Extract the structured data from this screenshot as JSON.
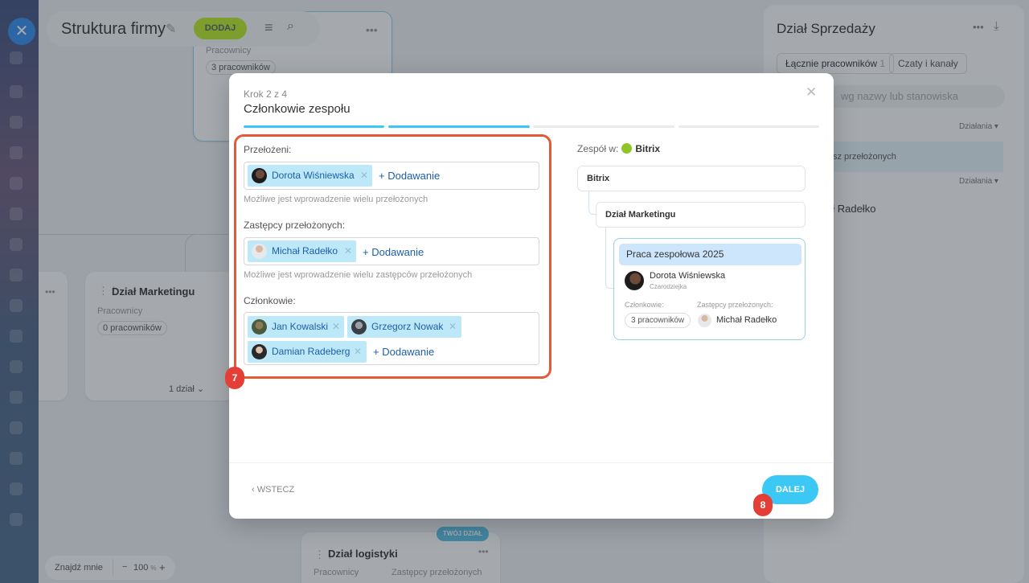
{
  "app": {
    "title": "Struktura firmy",
    "add_label": "DODAJ"
  },
  "background": {
    "top_card": {
      "employees_label": "Pracownicy",
      "employees_count": "3 pracowników"
    },
    "marketing_card": {
      "name": "Dział Marketingu",
      "employees_label": "Pracownicy",
      "employees_count": "0 pracowników",
      "subdept": "1 dział"
    },
    "logistics_card": {
      "badge": "TWÓJ DZIAŁ",
      "name": "Dział logistyki",
      "employees_label": "Pracownicy",
      "deputies_label": "Zastępcy przełożonych"
    },
    "right_panel": {
      "title": "Dział Sprzedaży",
      "tab_total": "Łącznie pracowników",
      "tab_total_count": "1",
      "tab_chats": "Czaty i kanały",
      "search_placeholder": "wg nazwy lub stanowiska",
      "actions_label": "Działania",
      "row_text": "sz przełożonych",
      "person": "ał Radełko"
    },
    "zoom": {
      "find_me": "Znajdź mnie",
      "zoom_value": "100",
      "zoom_unit": "%"
    }
  },
  "modal": {
    "step": "Krok 2 z 4",
    "title": "Członkowie zespołu",
    "progress": {
      "completed": 2,
      "total": 4
    },
    "supervisors": {
      "label": "Przełożeni:",
      "people": [
        "Dorota Wiśniewska"
      ],
      "add_label": "Dodawanie",
      "hint": "Możliwe jest wprowadzenie wielu przełożonych"
    },
    "deputies": {
      "label": "Zastępcy przełożonych:",
      "people": [
        "Michał Radełko"
      ],
      "add_label": "Dodawanie",
      "hint": "Możliwe jest wprowadzenie wielu zastępców przełożonych"
    },
    "members": {
      "label": "Członkowie:",
      "people": [
        "Jan Kowalski",
        "Grzegorz Nowak",
        "Damian Radeberg"
      ],
      "add_label": "Dodawanie"
    },
    "preview": {
      "team_in_label": "Zespół w:",
      "company": "Bitrix",
      "tree_root": "Bitrix",
      "tree_child": "Dział Marketingu",
      "team_name": "Praca zespołowa 2025",
      "head_name": "Dorota Wiśniewska",
      "head_role": "Czarodziejka",
      "members_label": "Członkowie:",
      "members_count": "3 pracowników",
      "deputies_label": "Zastępcy przełożonych:",
      "deputy_name": "Michał Radełko"
    },
    "back_label": "WSTECZ",
    "next_label": "DALEJ"
  },
  "annotations": {
    "badge_fields": "7",
    "badge_next": "8"
  },
  "colors": {
    "accent": "#3bc8f5",
    "chip": "#bde8f8",
    "highlight": "#e45a36",
    "badge": "#e43f36",
    "add": "#bbed21"
  }
}
